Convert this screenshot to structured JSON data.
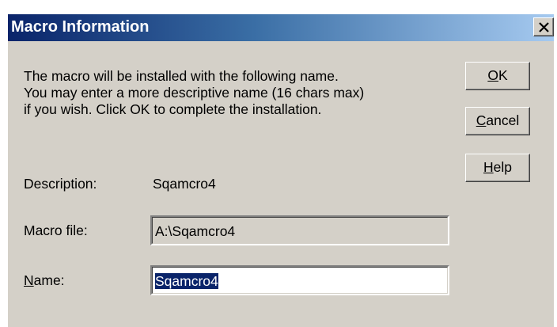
{
  "window": {
    "title": "Macro Information"
  },
  "message": {
    "line1": "The macro will be installed with the following name.",
    "line2": "You may enter a more descriptive name (16 chars max)",
    "line3": "if you wish. Click OK to complete the installation."
  },
  "fields": {
    "description_label": "Description:",
    "description_value": "Sqamcro4",
    "macro_file_label": "Macro file:",
    "macro_file_value": "A:\\Sqamcro4",
    "name_label_accel": "N",
    "name_label_rest": "ame:",
    "name_value": "Sqamcro4"
  },
  "buttons": {
    "ok_accel": "O",
    "ok_rest": "K",
    "cancel_accel": "C",
    "cancel_rest": "ancel",
    "help_accel": "H",
    "help_rest": "elp"
  },
  "colors": {
    "title_bar": "#0a246a",
    "dialog_face": "#d4d0c8",
    "selection": "#0a246a"
  },
  "icons": {
    "close": "close-icon"
  }
}
